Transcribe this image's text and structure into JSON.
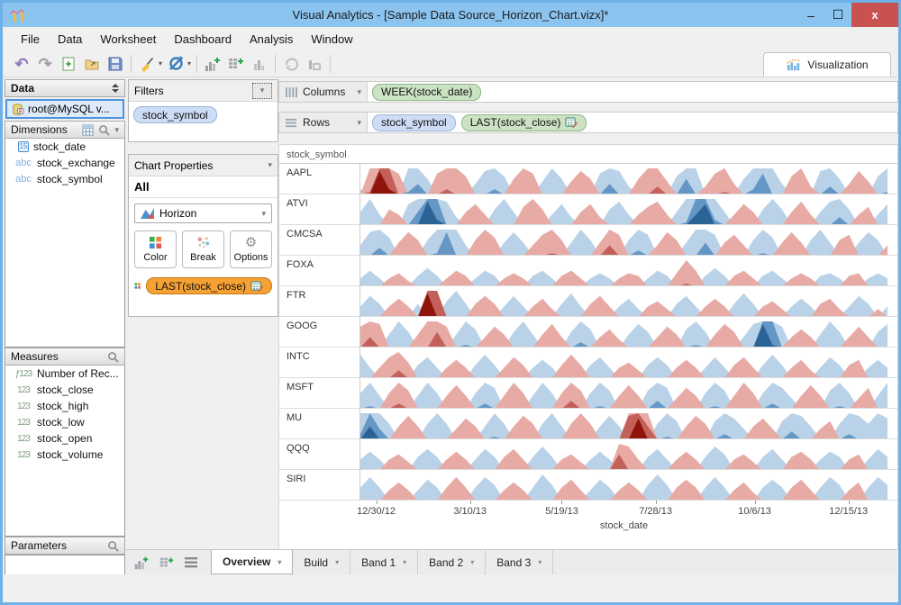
{
  "window": {
    "title": "Visual Analytics - [Sample Data Source_Horizon_Chart.vizx]*",
    "minimize_label": "–",
    "maximize_label": "☐",
    "close_label": "x"
  },
  "menu": {
    "items": [
      "File",
      "Data",
      "Worksheet",
      "Dashboard",
      "Analysis",
      "Window"
    ]
  },
  "toolbar": {
    "icons": [
      "undo-icon",
      "redo-icon",
      "new-sheet-icon",
      "open-icon",
      "save-icon",
      "format-brush-icon",
      "refresh-icon",
      "add-chart-icon",
      "add-crosstab-icon",
      "bar-chart-icon",
      "rotate-icon",
      "chart-box-icon"
    ],
    "visualization_label": "Visualization"
  },
  "data_panel": {
    "title": "Data",
    "connection": "root@MySQL v...",
    "dimensions": {
      "title": "Dimensions",
      "items": [
        {
          "icon": "date",
          "icon_text": "15",
          "label": "stock_date"
        },
        {
          "icon": "abc",
          "icon_text": "abc",
          "label": "stock_exchange"
        },
        {
          "icon": "abc",
          "icon_text": "abc",
          "label": "stock_symbol"
        }
      ]
    },
    "measures": {
      "title": "Measures",
      "items": [
        {
          "icon": "num",
          "icon_text": "ƒ123",
          "label": "Number of Rec..."
        },
        {
          "icon": "num",
          "icon_text": "123",
          "label": "stock_close"
        },
        {
          "icon": "num",
          "icon_text": "123",
          "label": "stock_high"
        },
        {
          "icon": "num",
          "icon_text": "123",
          "label": "stock_low"
        },
        {
          "icon": "num",
          "icon_text": "123",
          "label": "stock_open"
        },
        {
          "icon": "num",
          "icon_text": "123",
          "label": "stock_volume"
        }
      ]
    },
    "parameters": {
      "title": "Parameters"
    }
  },
  "filters_panel": {
    "title": "Filters",
    "pills": [
      {
        "label": "stock_symbol",
        "type": "blue"
      }
    ]
  },
  "properties_panel": {
    "title": "Chart Properties",
    "scope": "All",
    "chart_type": "Horizon",
    "buttons": [
      {
        "label": "Color",
        "icon": "color-grid"
      },
      {
        "label": "Break",
        "icon": "break-dots"
      },
      {
        "label": "Options",
        "icon": "gear"
      }
    ],
    "aesthetic_pill": {
      "label": "LAST(stock_close)",
      "type": "orange",
      "calc_icon": true
    }
  },
  "shelves": {
    "columns": {
      "label": "Columns",
      "pills": [
        {
          "label": "WEEK(stock_date)",
          "type": "green"
        }
      ]
    },
    "rows": {
      "label": "Rows",
      "pills": [
        {
          "label": "stock_symbol",
          "type": "blue"
        },
        {
          "label": "LAST(stock_close)",
          "type": "green",
          "calc_icon": true
        }
      ]
    }
  },
  "theme": {
    "titlebar": "#8cc4f0",
    "close_red": "#c85250",
    "pill_green": "#cbe3c3",
    "pill_blue": "#cdddf6",
    "pill_orange": "#f6a133"
  },
  "chart_data": {
    "type": "horizon",
    "row_header": "stock_symbol",
    "xlabel": "stock_date",
    "x_ticks": [
      "12/30/12",
      "3/10/13",
      "5/19/13",
      "7/28/13",
      "10/6/13",
      "12/15/13"
    ],
    "x_tick_pos": [
      0.03,
      0.208,
      0.382,
      0.56,
      0.748,
      0.926
    ],
    "band_levels": 3,
    "value_range": [
      -3,
      3
    ],
    "colors": {
      "positive": [
        "#b9d2e7",
        "#6496c6",
        "#2c6396"
      ],
      "negative": [
        "#e7aaa5",
        "#c4605a",
        "#8f150b"
      ]
    },
    "series": [
      {
        "name": "AAPL",
        "values": [
          0.2,
          -1.1,
          -2.9,
          -2.2,
          -0.8,
          1.1,
          1.4,
          0.6,
          -0.8,
          -1.2,
          -1.0,
          -0.7,
          0.4,
          0.9,
          1.2,
          0.7,
          -0.6,
          -1.0,
          -0.8,
          0.5,
          1.0,
          0.6,
          -0.5,
          -0.9,
          -0.6,
          0.8,
          1.4,
          0.9,
          0.3,
          -0.6,
          -1.0,
          -1.3,
          -0.5,
          0.7,
          1.6,
          1.0,
          -0.3,
          -0.8,
          -1.1,
          -0.4,
          0.6,
          1.2,
          1.8,
          1.0,
          0.4,
          -0.7,
          -1.0,
          -0.3,
          0.9,
          1.3,
          0.6,
          -0.4,
          -0.9,
          -0.5,
          0.7,
          1.1
        ]
      },
      {
        "name": "ATVI",
        "values": [
          0.5,
          1.0,
          0.4,
          -0.6,
          -0.4,
          0.8,
          1.5,
          2.9,
          2.2,
          0.9,
          0.3,
          -0.5,
          -0.8,
          -0.4,
          0.6,
          1.0,
          0.5,
          -0.7,
          -1.0,
          -0.6,
          0.4,
          0.8,
          0.3,
          -0.5,
          -0.8,
          -0.3,
          0.6,
          0.9,
          0.4,
          -0.4,
          -0.7,
          -0.9,
          -0.4,
          0.5,
          1.1,
          2.4,
          2.8,
          1.2,
          0.5,
          -0.4,
          -0.8,
          -0.5,
          0.6,
          1.0,
          0.6,
          -0.5,
          -0.9,
          -0.4,
          0.5,
          0.9,
          1.3,
          0.6,
          -0.4,
          -0.7,
          0.4,
          0.8
        ]
      },
      {
        "name": "CMCSA",
        "values": [
          0.4,
          0.9,
          1.3,
          0.7,
          -0.5,
          -0.9,
          -0.6,
          0.6,
          1.1,
          1.9,
          1.0,
          0.4,
          -0.6,
          -1.0,
          -0.7,
          0.5,
          0.9,
          0.5,
          -0.4,
          -0.8,
          -1.1,
          -0.6,
          0.5,
          1.0,
          0.6,
          -0.5,
          -1.4,
          -0.8,
          0.6,
          1.2,
          0.8,
          -0.4,
          -0.9,
          -0.6,
          0.5,
          1.0,
          1.5,
          0.8,
          -0.5,
          -0.8,
          -0.4,
          0.6,
          1.1,
          0.7,
          -0.5,
          -0.9,
          -0.5,
          0.6,
          1.0,
          0.5,
          -0.6,
          -0.8,
          0.5,
          0.9,
          0.6,
          -0.4
        ]
      },
      {
        "name": "FOXA",
        "values": [
          0.3,
          0.6,
          0.3,
          -0.3,
          -0.5,
          -0.2,
          0.4,
          0.7,
          0.4,
          -0.3,
          -0.6,
          -0.4,
          0.3,
          0.6,
          0.4,
          -0.3,
          -0.5,
          -0.3,
          0.4,
          0.6,
          0.3,
          -0.4,
          -0.6,
          -0.3,
          0.3,
          0.5,
          0.3,
          -0.3,
          -0.5,
          -0.4,
          0.3,
          0.6,
          0.4,
          -0.5,
          -1.1,
          -0.6,
          0.4,
          0.7,
          0.4,
          -0.4,
          -0.6,
          -0.3,
          0.4,
          0.6,
          0.3,
          -0.3,
          -0.5,
          -0.3,
          0.4,
          0.5,
          0.3,
          -0.4,
          -0.5,
          0.3,
          0.5,
          0.3
        ]
      },
      {
        "name": "FTR",
        "values": [
          0.4,
          0.8,
          0.5,
          -0.4,
          -0.7,
          -0.4,
          0.5,
          -2.9,
          -2.0,
          0.6,
          1.0,
          0.5,
          -0.5,
          -0.8,
          -0.5,
          0.4,
          0.8,
          0.4,
          -0.4,
          -0.7,
          -0.3,
          0.5,
          0.9,
          0.4,
          -0.5,
          -0.8,
          -0.4,
          0.4,
          0.7,
          0.3,
          -0.4,
          -0.6,
          -0.3,
          0.5,
          0.8,
          0.4,
          -0.4,
          -0.7,
          -0.4,
          0.5,
          0.9,
          0.5,
          -0.4,
          -0.6,
          -0.3,
          0.4,
          0.7,
          0.4,
          -0.5,
          -0.7,
          -0.3,
          0.4,
          0.8,
          0.5,
          -0.3,
          0.4
        ]
      },
      {
        "name": "GOOG",
        "values": [
          -0.8,
          -1.4,
          -0.9,
          0.5,
          1.0,
          0.6,
          -0.5,
          -1.0,
          -1.6,
          -0.8,
          0.5,
          1.1,
          0.7,
          -0.4,
          -0.8,
          -0.5,
          0.6,
          1.0,
          0.5,
          -0.5,
          -0.9,
          -0.4,
          0.6,
          1.2,
          0.7,
          -0.4,
          -0.7,
          -0.3,
          0.5,
          0.9,
          0.6,
          -0.4,
          -0.8,
          -0.5,
          0.7,
          1.1,
          0.6,
          -0.5,
          -0.9,
          -0.6,
          0.4,
          0.9,
          2.9,
          2.1,
          0.8,
          -0.4,
          -0.7,
          -0.4,
          0.5,
          1.0,
          0.6,
          -0.4,
          -0.8,
          -0.4,
          0.6,
          0.9
        ]
      },
      {
        "name": "INTC",
        "values": [
          0.9,
          0.4,
          -0.4,
          -0.8,
          -1.3,
          -0.6,
          0.5,
          0.8,
          0.4,
          -0.4,
          -0.7,
          -0.4,
          0.5,
          0.9,
          0.5,
          -0.4,
          -0.8,
          -0.5,
          0.4,
          0.7,
          0.4,
          -0.5,
          -0.9,
          -0.5,
          0.5,
          0.8,
          0.4,
          -0.4,
          -0.6,
          -0.3,
          0.5,
          0.8,
          0.5,
          -0.4,
          -0.7,
          -0.4,
          0.4,
          0.8,
          0.4,
          -0.5,
          -0.8,
          -0.4,
          0.5,
          0.9,
          0.5,
          -0.4,
          -0.7,
          -0.3,
          0.4,
          0.8,
          0.5,
          -0.5,
          -0.7,
          0.4,
          0.7,
          0.4
        ]
      },
      {
        "name": "MSFT",
        "values": [
          0.6,
          1.1,
          0.5,
          -0.6,
          -1.2,
          -0.7,
          0.5,
          1.0,
          0.6,
          -0.5,
          -0.9,
          -0.5,
          0.6,
          1.2,
          0.8,
          -0.5,
          -1.0,
          -0.6,
          0.5,
          1.0,
          0.6,
          -0.6,
          -1.3,
          -0.7,
          0.6,
          1.1,
          0.7,
          -0.5,
          -0.9,
          -0.5,
          0.7,
          1.3,
          0.8,
          -0.4,
          -0.8,
          -0.5,
          0.6,
          1.1,
          0.7,
          -0.5,
          -1.0,
          -0.6,
          0.6,
          1.2,
          0.8,
          0.4,
          -0.5,
          -0.9,
          -0.5,
          0.7,
          1.1,
          0.6,
          -0.4,
          -0.8,
          0.5,
          1.0
        ]
      },
      {
        "name": "MU",
        "values": [
          1.2,
          2.5,
          1.4,
          0.6,
          -0.5,
          -0.9,
          -0.5,
          0.6,
          1.0,
          0.6,
          -0.4,
          -0.8,
          -0.5,
          0.5,
          1.1,
          0.6,
          -0.5,
          -0.9,
          -0.6,
          0.6,
          1.0,
          0.5,
          -0.6,
          -1.0,
          -0.6,
          0.5,
          0.9,
          0.5,
          -1.9,
          -2.8,
          -1.5,
          0.6,
          1.1,
          0.7,
          -0.5,
          -0.9,
          -0.6,
          0.7,
          1.2,
          0.8,
          0.4,
          -0.5,
          -0.8,
          -0.4,
          0.7,
          1.3,
          0.9,
          0.5,
          -0.4,
          -0.7,
          0.6,
          1.2,
          0.9,
          0.6,
          1.0,
          0.8
        ]
      },
      {
        "name": "QQQ",
        "values": [
          0.4,
          0.7,
          0.4,
          -0.4,
          -0.6,
          -0.3,
          0.5,
          0.8,
          0.5,
          -0.4,
          -0.7,
          -0.4,
          0.4,
          0.8,
          0.5,
          -0.5,
          -0.8,
          -0.4,
          0.5,
          0.9,
          0.5,
          -0.4,
          -0.6,
          -0.3,
          0.4,
          0.7,
          0.4,
          -1.6,
          -0.9,
          -0.4,
          0.5,
          0.8,
          0.4,
          -0.4,
          -0.7,
          -0.4,
          0.5,
          0.9,
          0.6,
          -0.4,
          -0.6,
          -0.3,
          0.5,
          0.8,
          0.4,
          -0.5,
          -0.7,
          -0.4,
          0.4,
          0.7,
          0.5,
          -0.4,
          -0.6,
          0.4,
          0.8,
          0.5
        ]
      },
      {
        "name": "SIRI",
        "values": [
          0.5,
          0.9,
          0.5,
          -0.4,
          -0.7,
          -0.4,
          0.4,
          0.8,
          0.5,
          -0.5,
          -0.9,
          -0.5,
          0.5,
          0.9,
          0.6,
          -0.4,
          -0.7,
          -0.4,
          0.5,
          1.0,
          0.6,
          -0.5,
          -0.8,
          -0.4,
          0.4,
          0.8,
          0.5,
          -0.4,
          -0.7,
          -0.4,
          0.6,
          1.0,
          0.6,
          -0.5,
          -0.8,
          -0.5,
          0.5,
          0.9,
          0.5,
          -0.4,
          -0.7,
          -0.3,
          0.5,
          0.8,
          0.5,
          -0.5,
          -0.8,
          -0.4,
          0.5,
          0.9,
          0.6,
          -0.4,
          -0.7,
          0.5,
          0.9,
          0.6
        ]
      }
    ]
  },
  "footer": {
    "tabs": [
      {
        "label": "Overview",
        "active": true
      },
      {
        "label": "Build",
        "active": false
      },
      {
        "label": "Band 1",
        "active": false
      },
      {
        "label": "Band 2",
        "active": false
      },
      {
        "label": "Band 3",
        "active": false
      }
    ]
  }
}
